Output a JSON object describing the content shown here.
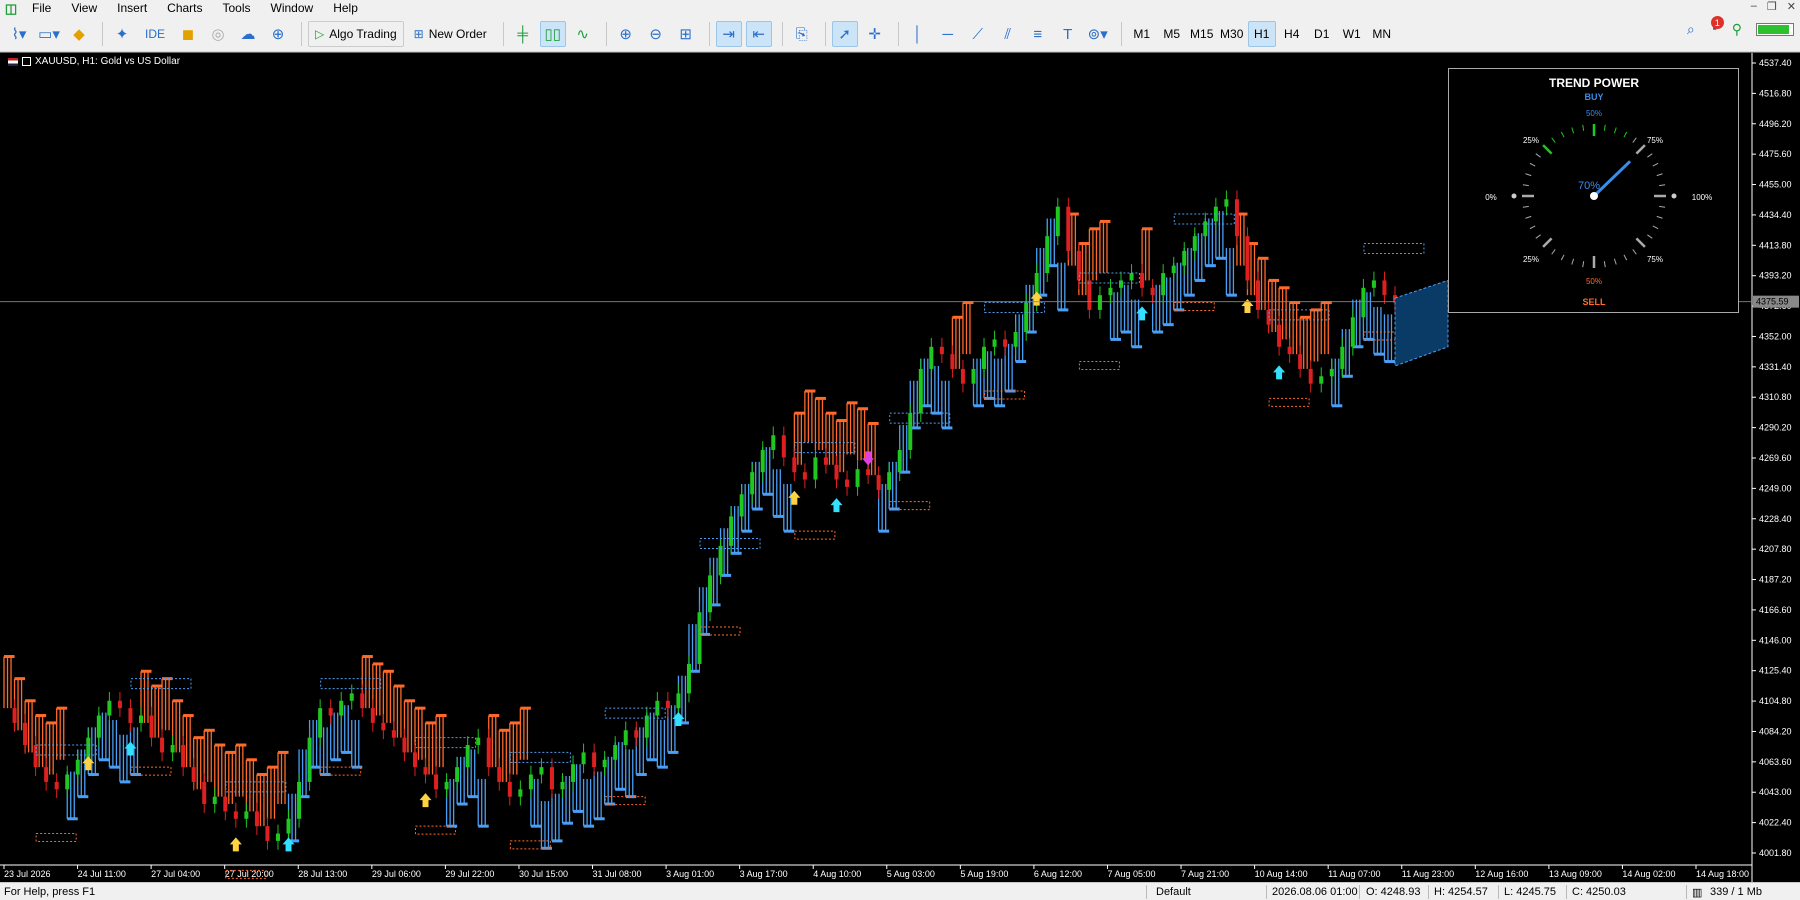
{
  "menu": {
    "items": [
      "File",
      "View",
      "Insert",
      "Charts",
      "Tools",
      "Window",
      "Help"
    ]
  },
  "toolbar": {
    "ide_label": "IDE",
    "algo_trading_label": "Algo Trading",
    "new_order_label": "New Order",
    "timeframes": [
      "M1",
      "M5",
      "M15",
      "M30",
      "H1",
      "H4",
      "D1",
      "W1",
      "MN"
    ],
    "active_timeframe": "H1",
    "notification_count": "1",
    "battery_level": 0.85
  },
  "chart": {
    "title": "XAUUSD, H1:  Gold vs US Dollar",
    "current_price": "4375.59",
    "price_axis": [
      "4537.40",
      "4516.80",
      "4496.20",
      "4475.60",
      "4455.00",
      "4434.40",
      "4413.80",
      "4393.20",
      "4372.60",
      "4352.00",
      "4331.40",
      "4310.80",
      "4290.20",
      "4269.60",
      "4249.00",
      "4228.40",
      "4207.80",
      "4187.20",
      "4166.60",
      "4146.00",
      "4125.40",
      "4104.80",
      "4084.20",
      "4063.60",
      "4043.00",
      "4022.40",
      "4001.80"
    ],
    "time_axis": [
      "23 Jul 2026",
      "24 Jul 11:00",
      "27 Jul 04:00",
      "27 Jul 20:00",
      "28 Jul 13:00",
      "29 Jul 06:00",
      "29 Jul 22:00",
      "30 Jul 15:00",
      "31 Jul 08:00",
      "3 Aug 01:00",
      "3 Aug 17:00",
      "4 Aug 10:00",
      "5 Aug 03:00",
      "5 Aug 19:00",
      "6 Aug 12:00",
      "7 Aug 05:00",
      "7 Aug 21:00",
      "10 Aug 14:00",
      "11 Aug 07:00",
      "11 Aug 23:00",
      "12 Aug 16:00",
      "13 Aug 09:00",
      "14 Aug 02:00",
      "14 Aug 18:00"
    ],
    "colors": {
      "bull": "#1ec81e",
      "bear": "#e02020",
      "cloud_up": "#4a9ff5",
      "cloud_down": "#ff6a2a",
      "arrow_yellow": "#ffd23f",
      "arrow_cyan": "#33e0ff",
      "arrow_magenta": "#e040e0"
    },
    "price_path": [
      4100,
      4090,
      4075,
      4060,
      4050,
      4045,
      4055,
      4065,
      4080,
      4095,
      4105,
      4100,
      4090,
      4095,
      4080,
      4070,
      4075,
      4060,
      4050,
      4035,
      4040,
      4030,
      4025,
      4030,
      4020,
      4010,
      4015,
      4025,
      4050,
      4080,
      4100,
      4095,
      4105,
      4110,
      4100,
      4090,
      4085,
      4080,
      4070,
      4060,
      4055,
      4045,
      4050,
      4060,
      4075,
      4080,
      4060,
      4050,
      4040,
      4045,
      4055,
      4060,
      4045,
      4050,
      4062,
      4070,
      4060,
      4065,
      4075,
      4085,
      4080,
      4095,
      4105,
      4100,
      4110,
      4130,
      4165,
      4190,
      4210,
      4230,
      4245,
      4260,
      4275,
      4285,
      4270,
      4260,
      4255,
      4270,
      4265,
      4255,
      4250,
      4262,
      4258,
      4248,
      4260,
      4275,
      4300,
      4330,
      4345,
      4340,
      4330,
      4320,
      4330,
      4345,
      4350,
      4345,
      4355,
      4375,
      4395,
      4420,
      4440,
      4410,
      4390,
      4370,
      4380,
      4385,
      4390,
      4395,
      4385,
      4380,
      4395,
      4400,
      4410,
      4420,
      4430,
      4440,
      4445,
      4420,
      4390,
      4370,
      4360,
      4345,
      4340,
      4330,
      4320,
      4325,
      4330,
      4345,
      4365,
      4385,
      4390,
      4380,
      4375
    ]
  },
  "trend_power": {
    "title": "TREND POWER",
    "buy_label": "BUY",
    "buy_pct": "50%",
    "sell_label": "SELL",
    "sell_pct": "50%",
    "value_label": "70%",
    "value": 70,
    "tick_0": "0%",
    "tick_100": "100%",
    "tick_25_top": "25%",
    "tick_75_top": "75%",
    "tick_25_bottom": "25%",
    "tick_75_bottom": "75%"
  },
  "status": {
    "help": "For Help, press F1",
    "profile": "Default",
    "datetime": "2026.08.06 01:00",
    "open": "O: 4248.93",
    "high": "H: 4254.57",
    "low": "L: 4245.75",
    "close": "C: 4250.03",
    "traffic": "339 / 1 Mb"
  }
}
